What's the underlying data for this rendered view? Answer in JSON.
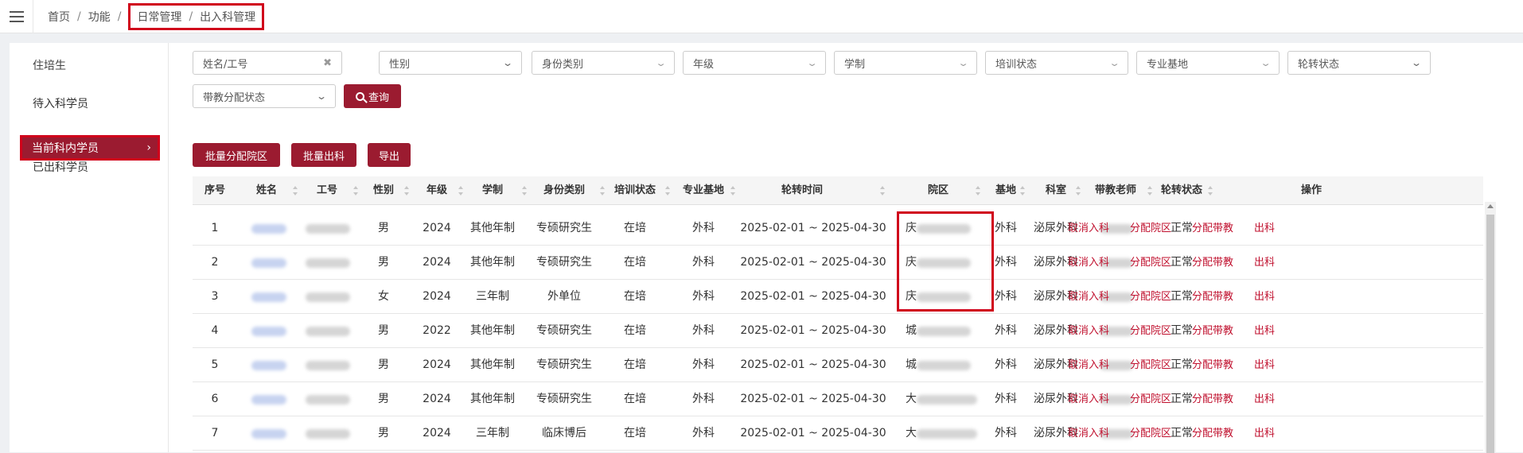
{
  "breadcrumb": {
    "home": "首页",
    "func": "功能",
    "daily": "日常管理",
    "current": "出入科管理",
    "sep": "/"
  },
  "sidebar": {
    "header": "住培生",
    "items": [
      {
        "label": "待入科学员"
      },
      {
        "label": "当前科内学员",
        "active": true
      },
      {
        "label": "已出科学员"
      }
    ],
    "active_arrow": "›"
  },
  "filters": {
    "name_placeholder": "姓名/工号",
    "gender": "性别",
    "identity": "身份类别",
    "grade": "年级",
    "system": "学制",
    "training_status": "培训状态",
    "base": "专业基地",
    "rotation_status": "轮转状态",
    "mentor_status": "带教分配状态",
    "query_label": "查询"
  },
  "actions": {
    "batch_assign": "批量分配院区",
    "batch_out": "批量出科",
    "export": "导出"
  },
  "table": {
    "columns": [
      "序号",
      "姓名",
      "工号",
      "性别",
      "年级",
      "学制",
      "身份类别",
      "培训状态",
      "专业基地",
      "轮转时间",
      "院区",
      "基地",
      "科室",
      "带教老师",
      "轮转状态",
      "操作"
    ],
    "row_actions": [
      "取消入科",
      "分配院区",
      "分配带教",
      "出科"
    ],
    "rows": [
      {
        "no": "1",
        "gender": "男",
        "grade": "2024",
        "system": "其他年制",
        "identity": "专硕研究生",
        "training": "在培",
        "base": "外科",
        "time": "2025-02-01 ~ 2025-04-30",
        "campus": "庆",
        "base2": "外科",
        "dept": "泌尿外科",
        "status": "正常"
      },
      {
        "no": "2",
        "gender": "男",
        "grade": "2024",
        "system": "其他年制",
        "identity": "专硕研究生",
        "training": "在培",
        "base": "外科",
        "time": "2025-02-01 ~ 2025-04-30",
        "campus": "庆",
        "base2": "外科",
        "dept": "泌尿外科",
        "status": "正常"
      },
      {
        "no": "3",
        "gender": "女",
        "grade": "2024",
        "system": "三年制",
        "identity": "外单位",
        "training": "在培",
        "base": "外科",
        "time": "2025-02-01 ~ 2025-04-30",
        "campus": "庆",
        "base2": "外科",
        "dept": "泌尿外科",
        "status": "正常"
      },
      {
        "no": "4",
        "gender": "男",
        "grade": "2022",
        "system": "其他年制",
        "identity": "专硕研究生",
        "training": "在培",
        "base": "外科",
        "time": "2025-02-01 ~ 2025-04-30",
        "campus": "城",
        "base2": "外科",
        "dept": "泌尿外科",
        "status": "正常"
      },
      {
        "no": "5",
        "gender": "男",
        "grade": "2024",
        "system": "其他年制",
        "identity": "专硕研究生",
        "training": "在培",
        "base": "外科",
        "time": "2025-02-01 ~ 2025-04-30",
        "campus": "城",
        "base2": "外科",
        "dept": "泌尿外科",
        "status": "正常"
      },
      {
        "no": "6",
        "gender": "男",
        "grade": "2024",
        "system": "其他年制",
        "identity": "专硕研究生",
        "training": "在培",
        "base": "外科",
        "time": "2025-02-01 ~ 2025-04-30",
        "campus": "大",
        "base2": "外科",
        "dept": "泌尿外科",
        "status": "正常"
      },
      {
        "no": "7",
        "gender": "男",
        "grade": "2024",
        "system": "三年制",
        "identity": "临床博后",
        "training": "在培",
        "base": "外科",
        "time": "2025-02-01 ~ 2025-04-30",
        "campus": "大",
        "base2": "外科",
        "dept": "泌尿外科",
        "status": "正常"
      }
    ]
  },
  "colors": {
    "primary": "#9b1b30",
    "highlight": "#d0021b",
    "link": "#c0102e"
  }
}
